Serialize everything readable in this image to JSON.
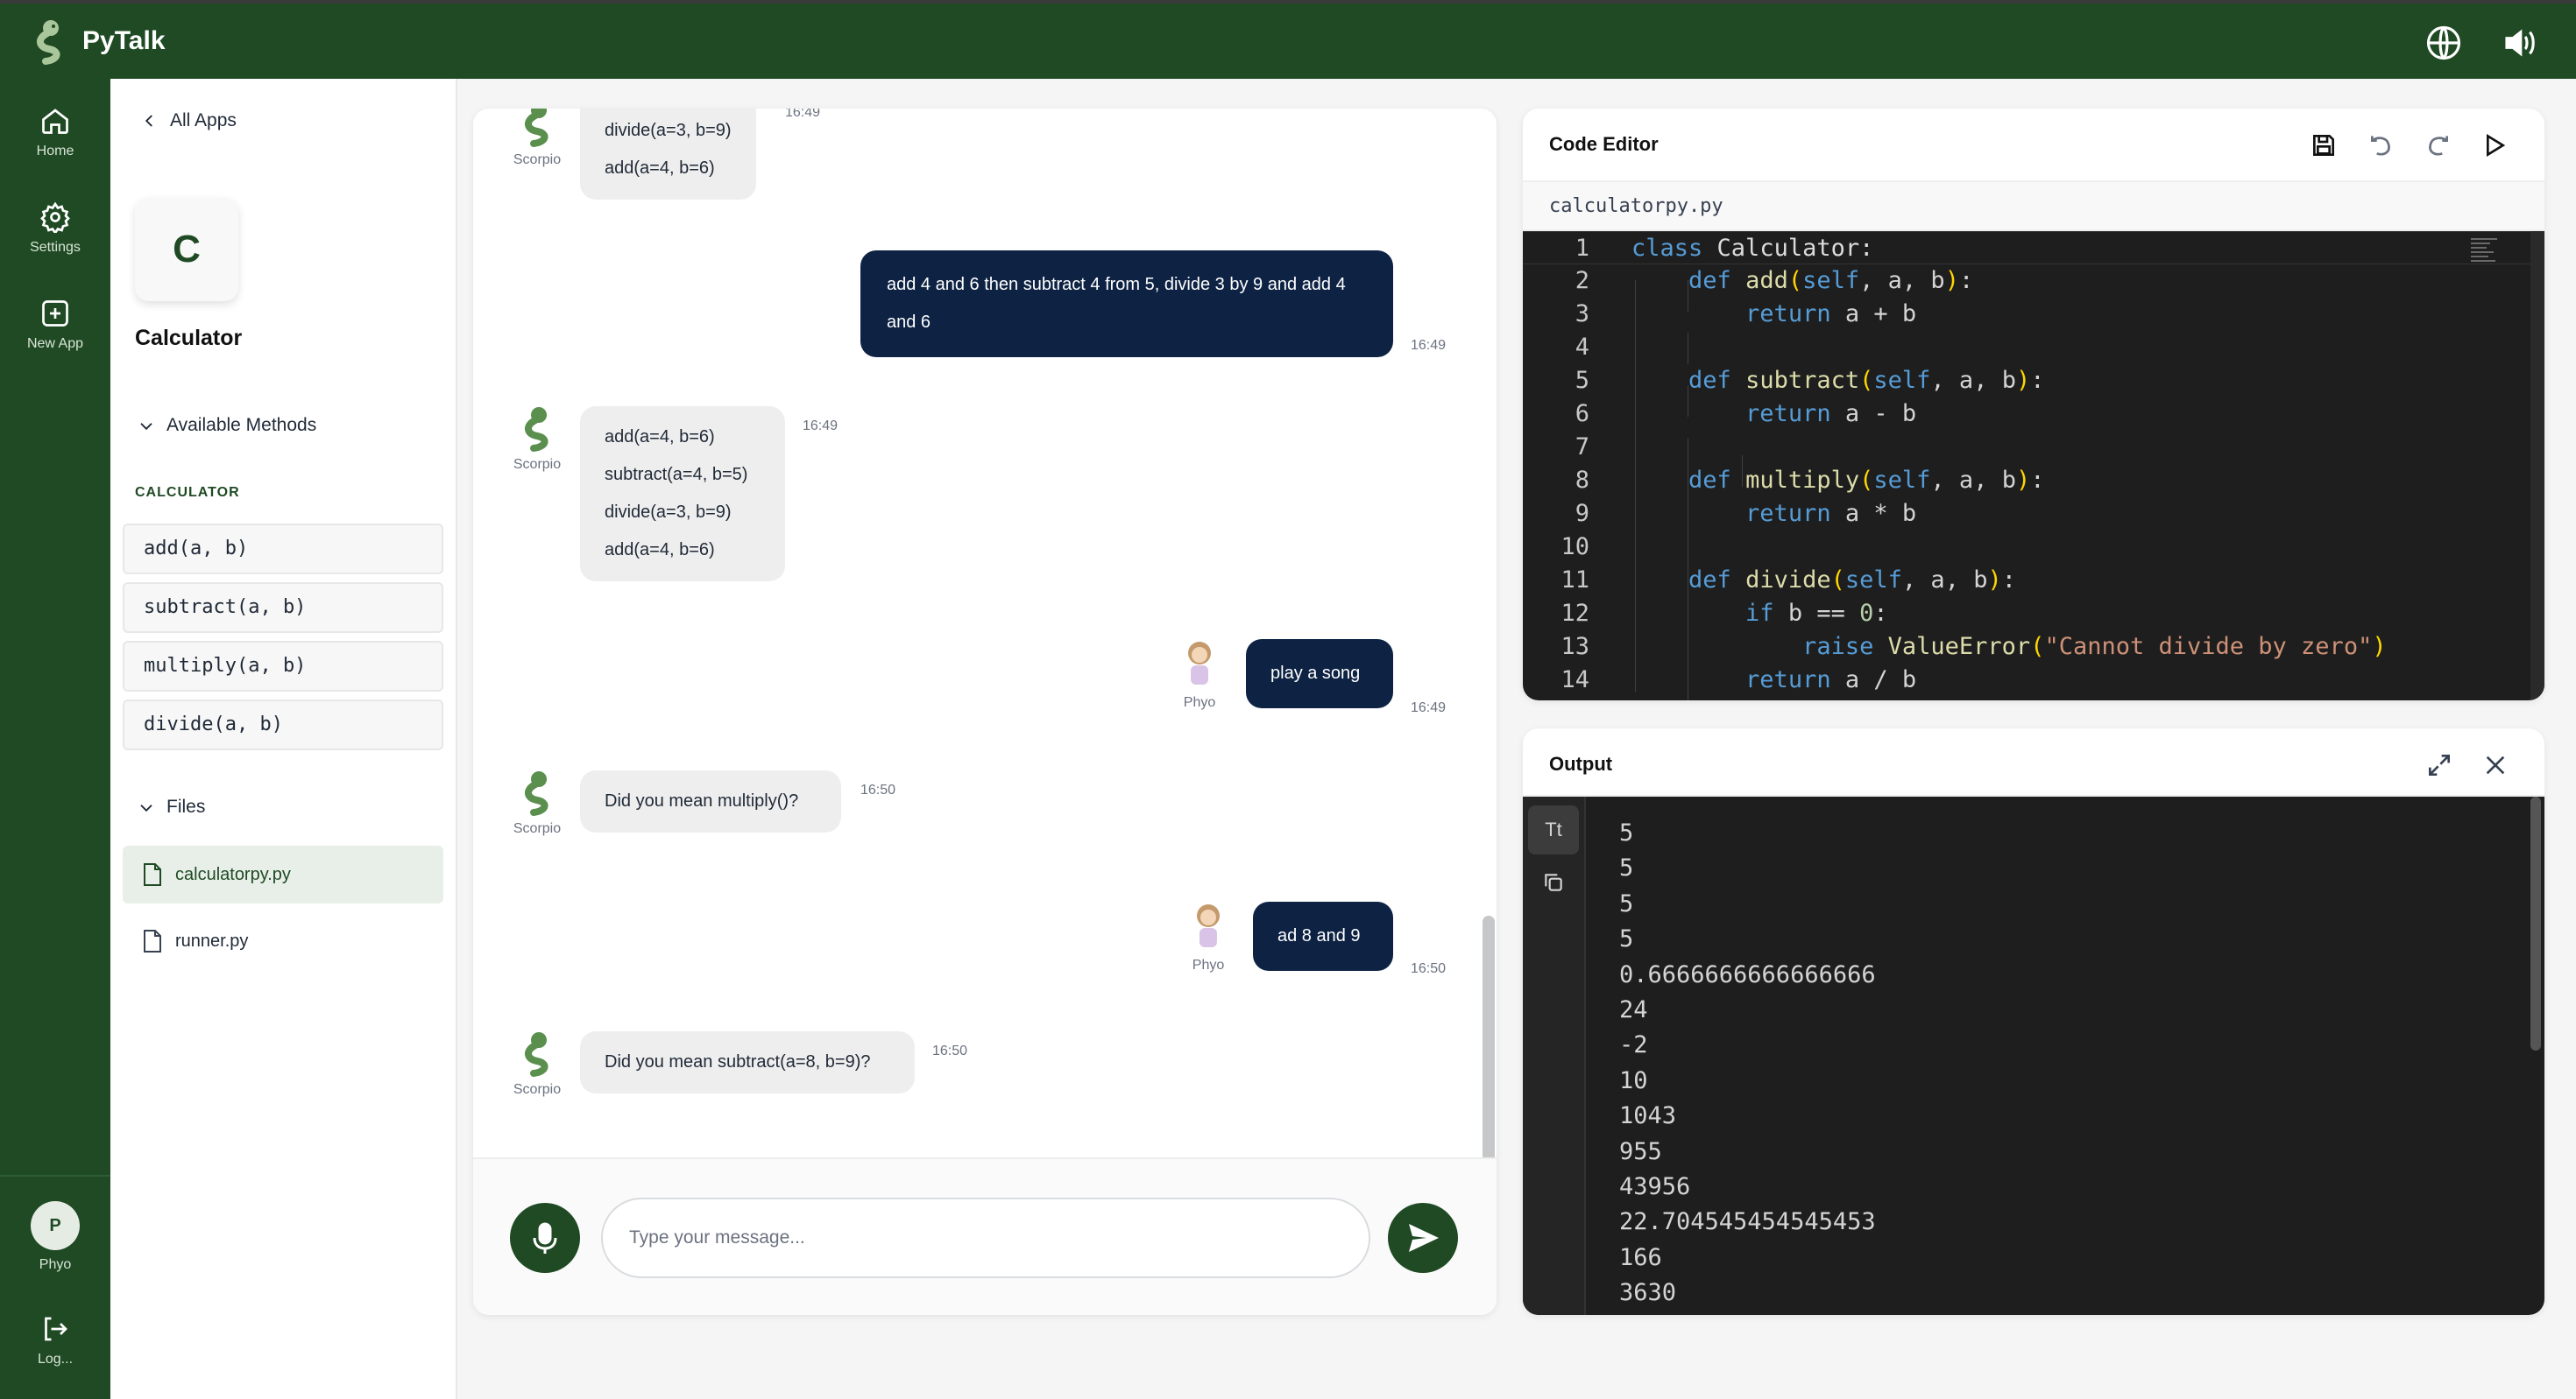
{
  "app": {
    "name": "PyTalk"
  },
  "rail": {
    "home": "Home",
    "settings": "Settings",
    "new_app": "New App",
    "user_initial": "P",
    "user_name": "Phyo",
    "logout": "Log..."
  },
  "side": {
    "back": "All Apps",
    "app_initial": "C",
    "app_name": "Calculator",
    "methods_toggle": "Available Methods",
    "methods_section": "CALCULATOR",
    "methods": [
      "add(a, b)",
      "subtract(a, b)",
      "multiply(a, b)",
      "divide(a, b)"
    ],
    "files_toggle": "Files",
    "files": [
      "calculatorpy.py",
      "runner.py"
    ]
  },
  "chat": {
    "bot_name": "Scorpio",
    "user_name": "Phyo",
    "m1_lines": [
      "divide(a=3, b=9)",
      "add(a=4, b=6)"
    ],
    "m1_time": "16:49",
    "m2_text": "add 4 and 6 then subtract 4 from 5, divide 3 by 9 and add 4 and 6",
    "m2_time": "16:49",
    "m3_lines": [
      "add(a=4, b=6)",
      "subtract(a=4, b=5)",
      "divide(a=3, b=9)",
      "add(a=4, b=6)"
    ],
    "m3_time": "16:49",
    "m4_text": "play a song",
    "m4_time": "16:49",
    "m5_text": "Did you mean multiply()?",
    "m5_time": "16:50",
    "m6_text": "ad 8 and 9",
    "m6_time": "16:50",
    "m7_text": "Did you mean subtract(a=8, b=9)?",
    "m7_time": "16:50",
    "input_placeholder": "Type your message..."
  },
  "editor": {
    "title": "Code Editor",
    "filename": "calculatorpy.py",
    "line_numbers": [
      "1",
      "2",
      "3",
      "4",
      "5",
      "6",
      "7",
      "8",
      "9",
      "10",
      "11",
      "12",
      "13",
      "14"
    ]
  },
  "output": {
    "title": "Output",
    "text_toggle": "Tt",
    "lines": [
      "5",
      "5",
      "5",
      "5",
      "0.6666666666666666",
      "24",
      "-2",
      "10",
      "1043",
      "955",
      "43956",
      "22.704545454545453",
      "166",
      "3630"
    ]
  }
}
